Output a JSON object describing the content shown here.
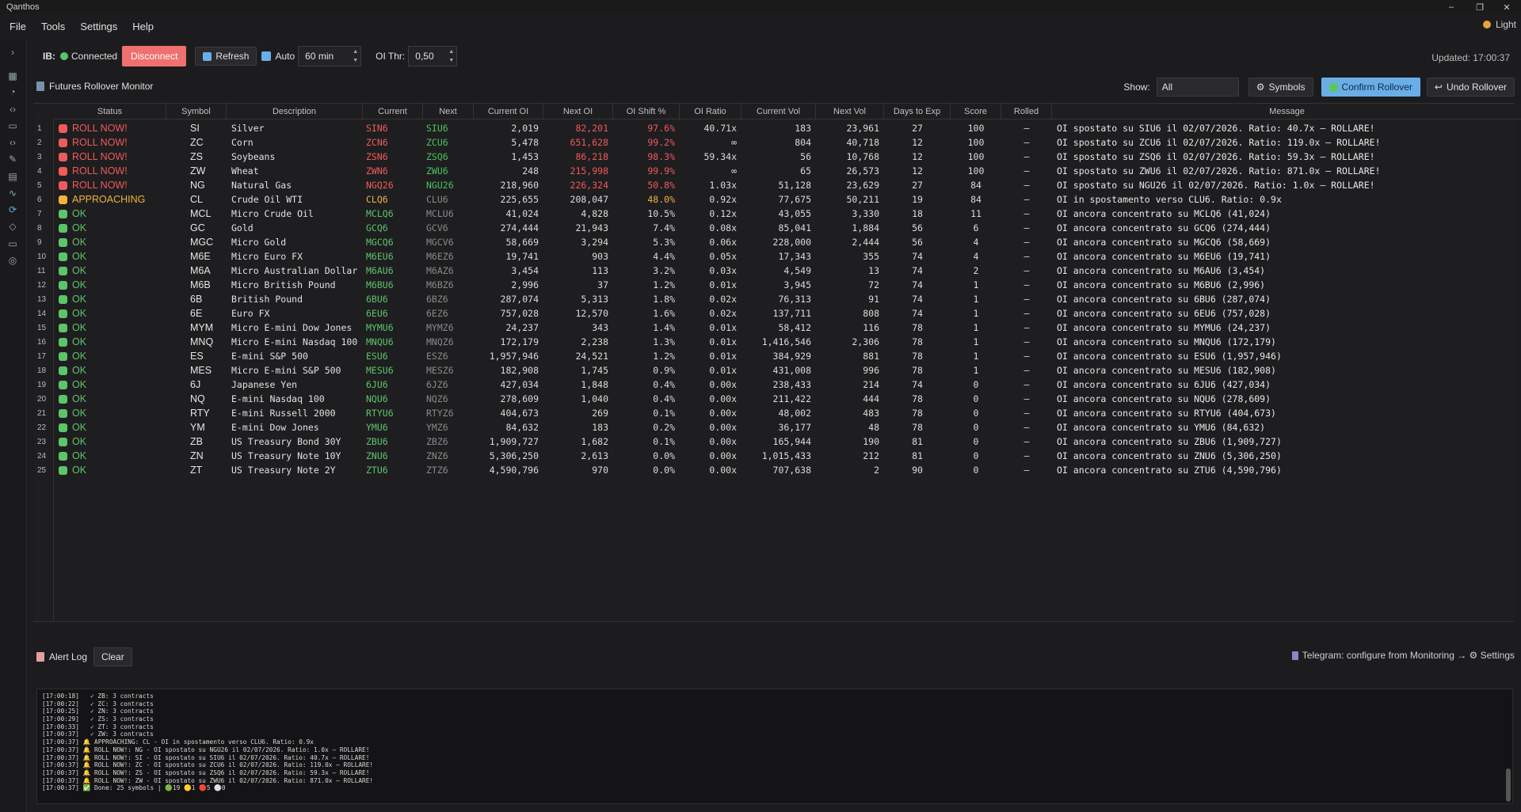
{
  "window": {
    "title": "Qanthos"
  },
  "menu": [
    "File",
    "Tools",
    "Settings",
    "Help"
  ],
  "theme_toggle": {
    "label": "Light"
  },
  "toolbar": {
    "ib_label": "IB:",
    "connection_status": "Connected",
    "disconnect_label": "Disconnect",
    "refresh_label": "Refresh",
    "auto_label": "Auto",
    "interval_value": "60 min",
    "oi_thr_label": "OI Thr:",
    "oi_thr_value": "0,50",
    "updated": "Updated: 17:00:37"
  },
  "panel": {
    "title": "Futures Rollover Monitor",
    "show_label": "Show:",
    "show_value": "All",
    "symbols_label": "Symbols",
    "confirm_label": "Confirm Rollover",
    "undo_label": "Undo Rollover"
  },
  "table": {
    "columns": [
      "Status",
      "Symbol",
      "Description",
      "Current",
      "Next",
      "Current OI",
      "Next OI",
      "OI Shift %",
      "OI Ratio",
      "Current Vol",
      "Next Vol",
      "Days to Exp",
      "Score",
      "Rolled",
      "Message"
    ],
    "rows": [
      {
        "n": "1",
        "status": "ROLL NOW!",
        "level": "roll",
        "symbol": "SI",
        "desc": "Silver",
        "cur": "SIN6",
        "next": "SIU6",
        "cur_oi": "2,019",
        "next_oi": "82,201",
        "shift": "97.6%",
        "ratio": "40.71x",
        "cur_vol": "183",
        "next_vol": "23,961",
        "days": "27",
        "score": "100",
        "rolled": "–",
        "msg": "OI spostato su SIU6 il 02/07/2026. Ratio: 40.7x — ROLLARE!"
      },
      {
        "n": "2",
        "status": "ROLL NOW!",
        "level": "roll",
        "symbol": "ZC",
        "desc": "Corn",
        "cur": "ZCN6",
        "next": "ZCU6",
        "cur_oi": "5,478",
        "next_oi": "651,628",
        "shift": "99.2%",
        "ratio": "∞",
        "cur_vol": "804",
        "next_vol": "40,718",
        "days": "12",
        "score": "100",
        "rolled": "–",
        "msg": "OI spostato su ZCU6 il 02/07/2026. Ratio: 119.0x — ROLLARE!"
      },
      {
        "n": "3",
        "status": "ROLL NOW!",
        "level": "roll",
        "symbol": "ZS",
        "desc": "Soybeans",
        "cur": "ZSN6",
        "next": "ZSQ6",
        "cur_oi": "1,453",
        "next_oi": "86,218",
        "shift": "98.3%",
        "ratio": "59.34x",
        "cur_vol": "56",
        "next_vol": "10,768",
        "days": "12",
        "score": "100",
        "rolled": "–",
        "msg": "OI spostato su ZSQ6 il 02/07/2026. Ratio: 59.3x — ROLLARE!"
      },
      {
        "n": "4",
        "status": "ROLL NOW!",
        "level": "roll",
        "symbol": "ZW",
        "desc": "Wheat",
        "cur": "ZWN6",
        "next": "ZWU6",
        "cur_oi": "248",
        "next_oi": "215,998",
        "shift": "99.9%",
        "ratio": "∞",
        "cur_vol": "65",
        "next_vol": "26,573",
        "days": "12",
        "score": "100",
        "rolled": "–",
        "msg": "OI spostato su ZWU6 il 02/07/2026. Ratio: 871.0x — ROLLARE!"
      },
      {
        "n": "5",
        "status": "ROLL NOW!",
        "level": "roll",
        "symbol": "NG",
        "desc": "Natural Gas",
        "cur": "NGQ26",
        "next": "NGU26",
        "cur_oi": "218,960",
        "next_oi": "226,324",
        "shift": "50.8%",
        "ratio": "1.03x",
        "cur_vol": "51,128",
        "next_vol": "23,629",
        "days": "27",
        "score": "84",
        "rolled": "–",
        "msg": "OI spostato su NGU26 il 02/07/2026. Ratio: 1.0x — ROLLARE!"
      },
      {
        "n": "6",
        "status": "APPROACHING",
        "level": "appr",
        "symbol": "CL",
        "desc": "Crude Oil WTI",
        "cur": "CLQ6",
        "next": "CLU6",
        "cur_oi": "225,655",
        "next_oi": "208,047",
        "shift": "48.0%",
        "ratio": "0.92x",
        "cur_vol": "77,675",
        "next_vol": "50,211",
        "days": "19",
        "score": "84",
        "rolled": "–",
        "msg": "OI in spostamento verso CLU6. Ratio: 0.9x"
      },
      {
        "n": "7",
        "status": "OK",
        "level": "ok",
        "symbol": "MCL",
        "desc": "Micro Crude Oil",
        "cur": "MCLQ6",
        "next": "MCLU6",
        "cur_oi": "41,024",
        "next_oi": "4,828",
        "shift": "10.5%",
        "ratio": "0.12x",
        "cur_vol": "43,055",
        "next_vol": "3,330",
        "days": "18",
        "score": "11",
        "rolled": "–",
        "msg": "OI ancora concentrato su MCLQ6 (41,024)"
      },
      {
        "n": "8",
        "status": "OK",
        "level": "ok",
        "symbol": "GC",
        "desc": "Gold",
        "cur": "GCQ6",
        "next": "GCV6",
        "cur_oi": "274,444",
        "next_oi": "21,943",
        "shift": "7.4%",
        "ratio": "0.08x",
        "cur_vol": "85,041",
        "next_vol": "1,884",
        "days": "56",
        "score": "6",
        "rolled": "–",
        "msg": "OI ancora concentrato su GCQ6 (274,444)"
      },
      {
        "n": "9",
        "status": "OK",
        "level": "ok",
        "symbol": "MGC",
        "desc": "Micro Gold",
        "cur": "MGCQ6",
        "next": "MGCV6",
        "cur_oi": "58,669",
        "next_oi": "3,294",
        "shift": "5.3%",
        "ratio": "0.06x",
        "cur_vol": "228,000",
        "next_vol": "2,444",
        "days": "56",
        "score": "4",
        "rolled": "–",
        "msg": "OI ancora concentrato su MGCQ6 (58,669)"
      },
      {
        "n": "10",
        "status": "OK",
        "level": "ok",
        "symbol": "M6E",
        "desc": "Micro Euro FX",
        "cur": "M6EU6",
        "next": "M6EZ6",
        "cur_oi": "19,741",
        "next_oi": "903",
        "shift": "4.4%",
        "ratio": "0.05x",
        "cur_vol": "17,343",
        "next_vol": "355",
        "days": "74",
        "score": "4",
        "rolled": "–",
        "msg": "OI ancora concentrato su M6EU6 (19,741)"
      },
      {
        "n": "11",
        "status": "OK",
        "level": "ok",
        "symbol": "M6A",
        "desc": "Micro Australian Dollar",
        "cur": "M6AU6",
        "next": "M6AZ6",
        "cur_oi": "3,454",
        "next_oi": "113",
        "shift": "3.2%",
        "ratio": "0.03x",
        "cur_vol": "4,549",
        "next_vol": "13",
        "days": "74",
        "score": "2",
        "rolled": "–",
        "msg": "OI ancora concentrato su M6AU6 (3,454)"
      },
      {
        "n": "12",
        "status": "OK",
        "level": "ok",
        "symbol": "M6B",
        "desc": "Micro British Pound",
        "cur": "M6BU6",
        "next": "M6BZ6",
        "cur_oi": "2,996",
        "next_oi": "37",
        "shift": "1.2%",
        "ratio": "0.01x",
        "cur_vol": "3,945",
        "next_vol": "72",
        "days": "74",
        "score": "1",
        "rolled": "–",
        "msg": "OI ancora concentrato su M6BU6 (2,996)"
      },
      {
        "n": "13",
        "status": "OK",
        "level": "ok",
        "symbol": "6B",
        "desc": "British Pound",
        "cur": "6BU6",
        "next": "6BZ6",
        "cur_oi": "287,074",
        "next_oi": "5,313",
        "shift": "1.8%",
        "ratio": "0.02x",
        "cur_vol": "76,313",
        "next_vol": "91",
        "days": "74",
        "score": "1",
        "rolled": "–",
        "msg": "OI ancora concentrato su 6BU6 (287,074)"
      },
      {
        "n": "14",
        "status": "OK",
        "level": "ok",
        "symbol": "6E",
        "desc": "Euro FX",
        "cur": "6EU6",
        "next": "6EZ6",
        "cur_oi": "757,028",
        "next_oi": "12,570",
        "shift": "1.6%",
        "ratio": "0.02x",
        "cur_vol": "137,711",
        "next_vol": "808",
        "days": "74",
        "score": "1",
        "rolled": "–",
        "msg": "OI ancora concentrato su 6EU6 (757,028)"
      },
      {
        "n": "15",
        "status": "OK",
        "level": "ok",
        "symbol": "MYM",
        "desc": "Micro E-mini Dow Jones",
        "cur": "MYMU6",
        "next": "MYMZ6",
        "cur_oi": "24,237",
        "next_oi": "343",
        "shift": "1.4%",
        "ratio": "0.01x",
        "cur_vol": "58,412",
        "next_vol": "116",
        "days": "78",
        "score": "1",
        "rolled": "–",
        "msg": "OI ancora concentrato su MYMU6 (24,237)"
      },
      {
        "n": "16",
        "status": "OK",
        "level": "ok",
        "symbol": "MNQ",
        "desc": "Micro E-mini Nasdaq 100",
        "cur": "MNQU6",
        "next": "MNQZ6",
        "cur_oi": "172,179",
        "next_oi": "2,238",
        "shift": "1.3%",
        "ratio": "0.01x",
        "cur_vol": "1,416,546",
        "next_vol": "2,306",
        "days": "78",
        "score": "1",
        "rolled": "–",
        "msg": "OI ancora concentrato su MNQU6 (172,179)"
      },
      {
        "n": "17",
        "status": "OK",
        "level": "ok",
        "symbol": "ES",
        "desc": "E-mini S&P 500",
        "cur": "ESU6",
        "next": "ESZ6",
        "cur_oi": "1,957,946",
        "next_oi": "24,521",
        "shift": "1.2%",
        "ratio": "0.01x",
        "cur_vol": "384,929",
        "next_vol": "881",
        "days": "78",
        "score": "1",
        "rolled": "–",
        "msg": "OI ancora concentrato su ESU6 (1,957,946)"
      },
      {
        "n": "18",
        "status": "OK",
        "level": "ok",
        "symbol": "MES",
        "desc": "Micro E-mini S&P 500",
        "cur": "MESU6",
        "next": "MESZ6",
        "cur_oi": "182,908",
        "next_oi": "1,745",
        "shift": "0.9%",
        "ratio": "0.01x",
        "cur_vol": "431,008",
        "next_vol": "996",
        "days": "78",
        "score": "1",
        "rolled": "–",
        "msg": "OI ancora concentrato su MESU6 (182,908)"
      },
      {
        "n": "19",
        "status": "OK",
        "level": "ok",
        "symbol": "6J",
        "desc": "Japanese Yen",
        "cur": "6JU6",
        "next": "6JZ6",
        "cur_oi": "427,034",
        "next_oi": "1,848",
        "shift": "0.4%",
        "ratio": "0.00x",
        "cur_vol": "238,433",
        "next_vol": "214",
        "days": "74",
        "score": "0",
        "rolled": "–",
        "msg": "OI ancora concentrato su 6JU6 (427,034)"
      },
      {
        "n": "20",
        "status": "OK",
        "level": "ok",
        "symbol": "NQ",
        "desc": "E-mini Nasdaq 100",
        "cur": "NQU6",
        "next": "NQZ6",
        "cur_oi": "278,609",
        "next_oi": "1,040",
        "shift": "0.4%",
        "ratio": "0.00x",
        "cur_vol": "211,422",
        "next_vol": "444",
        "days": "78",
        "score": "0",
        "rolled": "–",
        "msg": "OI ancora concentrato su NQU6 (278,609)"
      },
      {
        "n": "21",
        "status": "OK",
        "level": "ok",
        "symbol": "RTY",
        "desc": "E-mini Russell 2000",
        "cur": "RTYU6",
        "next": "RTYZ6",
        "cur_oi": "404,673",
        "next_oi": "269",
        "shift": "0.1%",
        "ratio": "0.00x",
        "cur_vol": "48,002",
        "next_vol": "483",
        "days": "78",
        "score": "0",
        "rolled": "–",
        "msg": "OI ancora concentrato su RTYU6 (404,673)"
      },
      {
        "n": "22",
        "status": "OK",
        "level": "ok",
        "symbol": "YM",
        "desc": "E-mini Dow Jones",
        "cur": "YMU6",
        "next": "YMZ6",
        "cur_oi": "84,632",
        "next_oi": "183",
        "shift": "0.2%",
        "ratio": "0.00x",
        "cur_vol": "36,177",
        "next_vol": "48",
        "days": "78",
        "score": "0",
        "rolled": "–",
        "msg": "OI ancora concentrato su YMU6 (84,632)"
      },
      {
        "n": "23",
        "status": "OK",
        "level": "ok",
        "symbol": "ZB",
        "desc": "US Treasury Bond 30Y",
        "cur": "ZBU6",
        "next": "ZBZ6",
        "cur_oi": "1,909,727",
        "next_oi": "1,682",
        "shift": "0.1%",
        "ratio": "0.00x",
        "cur_vol": "165,944",
        "next_vol": "190",
        "days": "81",
        "score": "0",
        "rolled": "–",
        "msg": "OI ancora concentrato su ZBU6 (1,909,727)"
      },
      {
        "n": "24",
        "status": "OK",
        "level": "ok",
        "symbol": "ZN",
        "desc": "US Treasury Note 10Y",
        "cur": "ZNU6",
        "next": "ZNZ6",
        "cur_oi": "5,306,250",
        "next_oi": "2,613",
        "shift": "0.0%",
        "ratio": "0.00x",
        "cur_vol": "1,015,433",
        "next_vol": "212",
        "days": "81",
        "score": "0",
        "rolled": "–",
        "msg": "OI ancora concentrato su ZNU6 (5,306,250)"
      },
      {
        "n": "25",
        "status": "OK",
        "level": "ok",
        "symbol": "ZT",
        "desc": "US Treasury Note 2Y",
        "cur": "ZTU6",
        "next": "ZTZ6",
        "cur_oi": "4,590,796",
        "next_oi": "970",
        "shift": "0.0%",
        "ratio": "0.00x",
        "cur_vol": "707,638",
        "next_vol": "2",
        "days": "90",
        "score": "0",
        "rolled": "–",
        "msg": "OI ancora concentrato su ZTU6 (4,590,796)"
      }
    ]
  },
  "alert_log": {
    "title": "Alert Log",
    "clear_label": "Clear",
    "telegram_hint": "Telegram: configure from Monitoring → ⚙ Settings",
    "lines": [
      "[17:00:18]   ✓ ZB: 3 contracts",
      "[17:00:22]   ✓ ZC: 3 contracts",
      "[17:00:25]   ✓ ZN: 3 contracts",
      "[17:00:29]   ✓ ZS: 3 contracts",
      "[17:00:33]   ✓ ZT: 3 contracts",
      "[17:00:37]   ✓ ZW: 3 contracts",
      "[17:00:37] 🔔 APPROACHING: CL - OI in spostamento verso CLU6. Ratio: 0.9x",
      "[17:00:37] 🔔 ROLL NOW!: NG - OI spostato su NGU26 il 02/07/2026. Ratio: 1.0x — ROLLARE!",
      "[17:00:37] 🔔 ROLL NOW!: SI - OI spostato su SIU6 il 02/07/2026. Ratio: 40.7x — ROLLARE!",
      "[17:00:37] 🔔 ROLL NOW!: ZC - OI spostato su ZCU6 il 02/07/2026. Ratio: 119.0x — ROLLARE!",
      "[17:00:37] 🔔 ROLL NOW!: ZS - OI spostato su ZSQ6 il 02/07/2026. Ratio: 59.3x — ROLLARE!",
      "[17:00:37] 🔔 ROLL NOW!: ZW - OI spostato su ZWU6 il 02/07/2026. Ratio: 871.0x — ROLLARE!",
      "[17:00:37] ✅ Done: 25 symbols | 🟢19 🟡1 🔴5 ⚪0"
    ]
  },
  "colors": {
    "roll": "#f05a5a",
    "appr": "#f0b43c",
    "ok": "#5dc46a",
    "next_green": "#4cc35a",
    "next_gray": "#8a8a8a",
    "accent": "#6aaee8"
  }
}
